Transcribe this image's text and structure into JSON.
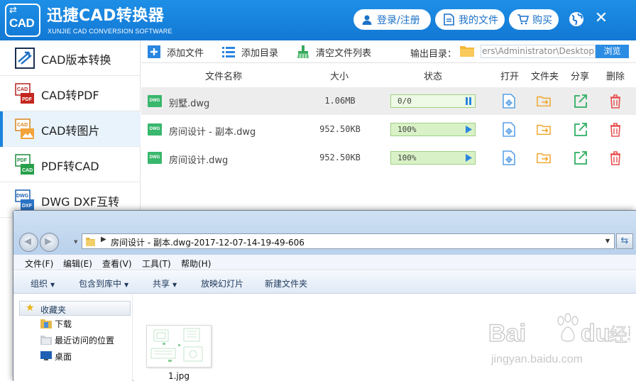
{
  "app": {
    "logo_text": "CAD",
    "title": "迅捷CAD转换器",
    "subtitle": "XUNJIE CAD CONVERSION SOFTWARE",
    "login_label": "登录/注册",
    "myfiles_label": "我的文件",
    "buy_label": "购买",
    "accent_color": "#1a82dd"
  },
  "sidebar": {
    "items": [
      {
        "label": "CAD版本转换",
        "icon": "cad-version-convert-icon"
      },
      {
        "label": "CAD转PDF",
        "icon": "cad-to-pdf-icon"
      },
      {
        "label": "CAD转图片",
        "icon": "cad-to-image-icon",
        "active": true
      },
      {
        "label": "PDF转CAD",
        "icon": "pdf-to-cad-icon"
      },
      {
        "label": "DWG DXF互转",
        "icon": "dwg-dxf-convert-icon"
      }
    ]
  },
  "toolbar": {
    "add_file": "添加文件",
    "add_folder": "添加目录",
    "clear_list": "清空文件列表",
    "output_label": "输出目录：",
    "output_path": "ers\\Administrator\\Desktop",
    "browse": "浏览"
  },
  "file_list": {
    "headers": {
      "name": "文件名称",
      "size": "大小",
      "status": "状态",
      "open": "打开",
      "folder": "文件夹",
      "share": "分享",
      "delete": "删除"
    },
    "rows": [
      {
        "icon_text": "DWG",
        "name": "别墅.dwg",
        "size": "1.06MB",
        "status": "0/0",
        "progress": 0,
        "control": "pause"
      },
      {
        "icon_text": "DWG",
        "name": "房间设计 - 副本.dwg",
        "size": "952.50KB",
        "status": "100%",
        "progress": 1,
        "control": "play"
      },
      {
        "icon_text": "DWG",
        "name": "房间设计.dwg",
        "size": "952.50KB",
        "status": "100%",
        "progress": 1,
        "control": "play"
      }
    ]
  },
  "explorer": {
    "address": "房间设计 - 副本.dwg-2017-12-07-14-19-49-606",
    "menus": [
      "文件(F)",
      "编辑(E)",
      "查看(V)",
      "工具(T)",
      "帮助(H)"
    ],
    "commands": [
      {
        "label": "组织",
        "dropdown": true
      },
      {
        "label": "包含到库中",
        "dropdown": true
      },
      {
        "label": "共享",
        "dropdown": true
      },
      {
        "label": "放映幻灯片",
        "dropdown": false
      },
      {
        "label": "新建文件夹",
        "dropdown": false
      }
    ],
    "favorites_label": "收藏夹",
    "nav_items": [
      "下载",
      "最近访问的位置",
      "桌面"
    ],
    "files": [
      {
        "name": "1.jpg"
      }
    ]
  },
  "watermark": {
    "brand": "Bai",
    "brand2": "du",
    "cn": "经验",
    "url": "jingyan.baidu.com"
  }
}
